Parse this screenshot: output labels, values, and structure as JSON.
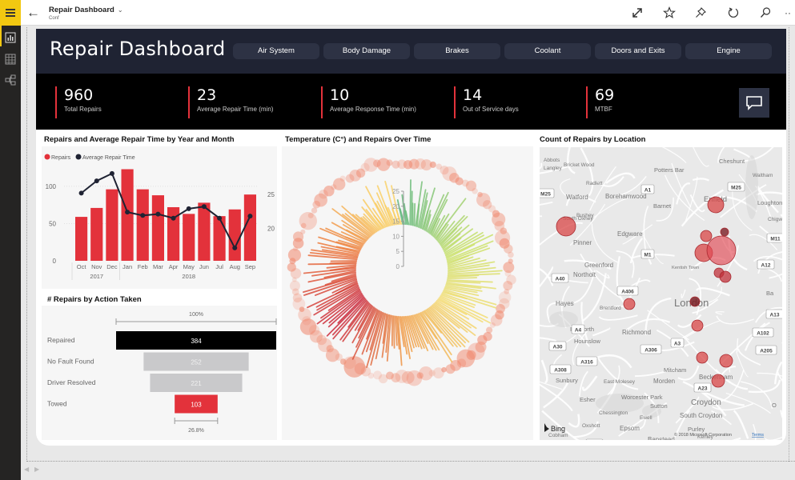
{
  "app": {
    "title": "Repair Dashboard",
    "subtitle": "Conf",
    "toolbar_icons": [
      "fullscreen-icon",
      "favorite-icon",
      "pin-icon",
      "refresh-icon",
      "search-icon",
      "more-icon"
    ]
  },
  "leftnav": {
    "items": [
      "report-view",
      "data-view",
      "model-view"
    ]
  },
  "report": {
    "title": "Repair Dashboard",
    "categories": [
      "Air System",
      "Body Damage",
      "Brakes",
      "Coolant",
      "Doors and Exits",
      "Engine"
    ],
    "kpis": [
      {
        "value": "960",
        "label": "Total Repairs"
      },
      {
        "value": "23",
        "label": "Average Repair Time (min)"
      },
      {
        "value": "10",
        "label": "Average Response Time (min)"
      },
      {
        "value": "14",
        "label": "Out of Service days"
      },
      {
        "value": "69",
        "label": "MTBF"
      }
    ]
  },
  "chart_data": [
    {
      "type": "bar",
      "title": "Repairs and Average Repair Time by Year and Month",
      "legend": [
        "Repairs",
        "Average Repair Time"
      ],
      "legend_position": "top-left",
      "categories": [
        "Oct",
        "Nov",
        "Dec",
        "Jan",
        "Feb",
        "Mar",
        "Apr",
        "May",
        "Jun",
        "Jul",
        "Aug",
        "Sep"
      ],
      "year_groups": [
        {
          "label": "2017",
          "span": 3
        },
        {
          "label": "2018",
          "span": 9
        }
      ],
      "series": [
        {
          "name": "Repairs",
          "type": "bar",
          "axis": "left",
          "color": "#e3323b",
          "values": [
            59,
            71,
            96,
            123,
            96,
            88,
            72,
            63,
            78,
            60,
            69,
            89
          ]
        },
        {
          "name": "Average Repair Time",
          "type": "line",
          "axis": "right",
          "color": "#1f2333",
          "values": [
            25.2,
            27.0,
            28.1,
            22.4,
            21.9,
            22.1,
            21.5,
            22.9,
            23.2,
            21.5,
            17.1,
            21.8
          ]
        }
      ],
      "y_left": {
        "ticks": [
          0,
          50,
          100
        ],
        "range": [
          0,
          130
        ]
      },
      "y_right": {
        "ticks": [
          20,
          25
        ],
        "range": [
          15.2,
          29.5
        ]
      }
    },
    {
      "type": "funnel",
      "title": "# Repairs by Action Taken",
      "categories": [
        "Repaired",
        "No Fault Found",
        "Driver Resolved",
        "Towed"
      ],
      "values": [
        384,
        252,
        221,
        103
      ],
      "colors": [
        "#000000",
        "#c9c9cb",
        "#c9c9cb",
        "#e3323b"
      ],
      "top_label": "100%",
      "bottom_label": "26.8%"
    },
    {
      "type": "radial",
      "title": "Temperature (C°) and Repairs Over Time",
      "axis_ticks": [
        0,
        5,
        10,
        15,
        20,
        25
      ]
    },
    {
      "type": "map",
      "title": "Count of Repairs by Location",
      "attribution": "© 2018 Microsoft Corporation",
      "terms_link": "Terms",
      "provider": "Bing",
      "place_labels": [
        "Bricket Wood",
        "Abbots Langley",
        "Radlett",
        "Potters Bar",
        "Cheshunt",
        "Waltham",
        "Watford",
        "Borehamwood",
        "Barnet",
        "Enfield",
        "Loughton",
        "Bushey",
        "South Oxhey",
        "Chigwell",
        "Edgware",
        "Pinner",
        "Greenford",
        "Northolt",
        "Kentish Town",
        "Hayes",
        "Brentford",
        "London",
        "Isleworth",
        "Hounslow",
        "Richmond",
        "Mitcham",
        "Beckenham",
        "Sunbury",
        "East Molesey",
        "Morden",
        "Esher",
        "Worcester Park",
        "Croydon",
        "Chessington",
        "Sutton",
        "Ewell",
        "South Croydon",
        "Oxshott",
        "Epsom",
        "Purley",
        "Cobham",
        "Banstead",
        "Kenley"
      ],
      "road_labels": [
        "M25",
        "A1",
        "M25",
        "M11",
        "M1",
        "A12",
        "A40",
        "A406",
        "A13",
        "A4",
        "A102",
        "A30",
        "A3",
        "A306",
        "A205",
        "A316",
        "A308",
        "A23",
        "M25"
      ]
    }
  ]
}
